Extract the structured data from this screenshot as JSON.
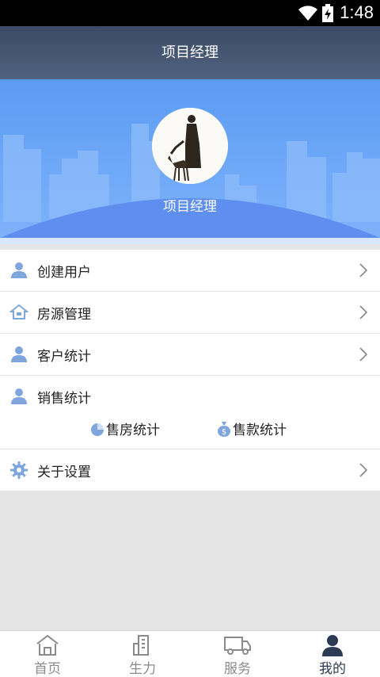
{
  "status_bar": {
    "time": "1:48",
    "icons": [
      "wifi-icon",
      "battery-icon"
    ]
  },
  "title_bar": {
    "title": "项目经理"
  },
  "profile": {
    "name": "项目经理",
    "avatar": "avatar"
  },
  "menu": {
    "create_user": "创建用户",
    "listings": "房源管理",
    "customer_stats": "客户统计",
    "sales_stats": "销售统计",
    "house_sales_stats": "售房统计",
    "payment_stats": "售款统计",
    "settings": "关于设置"
  },
  "bottom_nav": {
    "home": "首页",
    "productivity": "生力",
    "service": "服务",
    "mine": "我的",
    "active": "mine"
  },
  "colors": {
    "title_bar": "#3b4a66",
    "banner": "#6aa5f8",
    "icon_blue": "#7fa6dc",
    "active_tab": "#2e3b55"
  }
}
